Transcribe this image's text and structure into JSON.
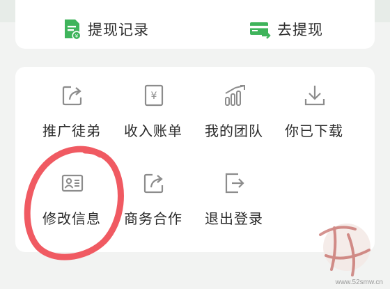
{
  "top_actions": [
    {
      "label": "提现记录",
      "icon": "withdraw-record-icon",
      "color": "#3fb45b"
    },
    {
      "label": "去提现",
      "icon": "withdraw-card-icon",
      "color": "#3fb45b"
    }
  ],
  "grid": [
    {
      "label": "推广徒弟",
      "icon": "share-icon"
    },
    {
      "label": "收入账单",
      "icon": "bill-icon"
    },
    {
      "label": "我的团队",
      "icon": "team-chart-icon"
    },
    {
      "label": "你已下载",
      "icon": "download-icon"
    },
    {
      "label": "修改信息",
      "icon": "profile-card-icon"
    },
    {
      "label": "商务合作",
      "icon": "share-icon"
    },
    {
      "label": "退出登录",
      "icon": "logout-icon"
    }
  ],
  "annotation": {
    "color": "#f05a62"
  },
  "watermark": {
    "url": "www.52smw.cn"
  }
}
